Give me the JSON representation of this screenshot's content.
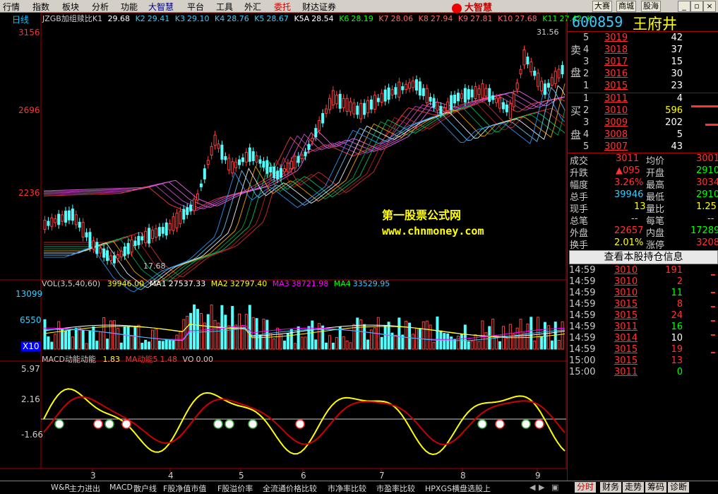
{
  "menu": {
    "items": [
      "行情",
      "指数",
      "板块",
      "分析",
      "功能",
      "大智慧",
      "平台",
      "工具",
      "外汇",
      "委托",
      "财达证券"
    ],
    "brand": "大智慧",
    "right_buttons": [
      "大赛",
      "商城",
      "股海"
    ]
  },
  "chart": {
    "period_label": "日线",
    "header": {
      "title": "JZGB加组赎比K1",
      "k_values": [
        {
          "k": "K1",
          "v": "29.68"
        },
        {
          "k": "K2",
          "v": "29.41"
        },
        {
          "k": "K3",
          "v": "29.10"
        },
        {
          "k": "K4",
          "v": "28.76"
        },
        {
          "k": "K5",
          "v": "28.67"
        },
        {
          "k": "K5A",
          "v": "28.54"
        },
        {
          "k": "K6",
          "v": "28.19"
        },
        {
          "k": "K7",
          "v": "28.06"
        },
        {
          "k": "K8",
          "v": "27.94"
        },
        {
          "k": "K9",
          "v": "27.81"
        },
        {
          "k": "K10",
          "v": "27.68"
        },
        {
          "k": "K11",
          "v": "27.42"
        },
        {
          "k": "K",
          "v": ""
        }
      ]
    },
    "price_axis": [
      "3156",
      "2696",
      "2236"
    ],
    "high_annotation": "31.56",
    "low_annotation": "17.68",
    "watermark_1": "第一股票公式网",
    "watermark_2": "www.chnmoney.com",
    "vol_header": {
      "label": "VOL(3,5,40,60)",
      "v": "39946.00",
      "ma1_label": "MA1",
      "ma1": "27537.33",
      "ma2_label": "MA2",
      "ma2": "32797.40",
      "ma3_label": "MA3",
      "ma3": "38721.98",
      "ma4_label": "MA4",
      "ma4": "33529.95"
    },
    "vol_axis": [
      "13099",
      "6550",
      "X10"
    ],
    "macd_header": {
      "label": "MACD动能动能",
      "v1": "1.83",
      "ma_label": "MA动能5",
      "v2": "1.48",
      "vo_label": "VO",
      "v3": "0.00"
    },
    "macd_axis": [
      "5.97",
      "2.16",
      "-1.66"
    ],
    "x_axis": [
      "3",
      "4",
      "5",
      "6",
      "7",
      "8",
      "9"
    ]
  },
  "quote": {
    "code": "600859",
    "name": "王府井",
    "sell_label": [
      "卖",
      "盘"
    ],
    "buy_label": [
      "买",
      "盘"
    ],
    "sell": [
      {
        "n": "5",
        "p": "3019",
        "v": "42"
      },
      {
        "n": "4",
        "p": "3018",
        "v": "37"
      },
      {
        "n": "3",
        "p": "3017",
        "v": "15"
      },
      {
        "n": "2",
        "p": "3016",
        "v": "30"
      },
      {
        "n": "1",
        "p": "3015",
        "v": "23"
      }
    ],
    "buy": [
      {
        "n": "1",
        "p": "3011",
        "v": "4"
      },
      {
        "n": "2",
        "p": "3010",
        "v": "596"
      },
      {
        "n": "3",
        "p": "3009",
        "v": "202"
      },
      {
        "n": "4",
        "p": "3008",
        "v": "5"
      },
      {
        "n": "5",
        "p": "3007",
        "v": "43"
      }
    ],
    "stats": [
      {
        "l1": "成交",
        "v1": "3011",
        "l2": "均价",
        "v2": "3001"
      },
      {
        "l1": "升跌",
        "v1": "▲095",
        "l2": "开盘",
        "v2": "2910"
      },
      {
        "l1": "幅度",
        "v1": "3.26%",
        "l2": "最高",
        "v2": "3034"
      },
      {
        "l1": "总手",
        "v1": "39946",
        "l2": "最低",
        "v2": "2910"
      },
      {
        "l1": "现手",
        "v1": "13",
        "l2": "量比",
        "v2": "1.25"
      },
      {
        "l1": "总笔",
        "v1": "--",
        "l2": "每笔",
        "v2": "--"
      },
      {
        "l1": "外盘",
        "v1": "22657",
        "l2": "内盘",
        "v2": "17289"
      },
      {
        "l1": "换手",
        "v1": "2.01%",
        "l2": "涨停",
        "v2": "3208"
      }
    ],
    "holdings_button": "查看本股持仓信息",
    "ticks": [
      {
        "t": "14:59",
        "p": "3010",
        "v": "191"
      },
      {
        "t": "14:59",
        "p": "3010",
        "v": "2"
      },
      {
        "t": "14:59",
        "p": "3010",
        "v": "11"
      },
      {
        "t": "14:59",
        "p": "3015",
        "v": "8"
      },
      {
        "t": "14:59",
        "p": "3015",
        "v": "24"
      },
      {
        "t": "14:59",
        "p": "3011",
        "v": "16"
      },
      {
        "t": "14:59",
        "p": "3014",
        "v": "10"
      },
      {
        "t": "14:59",
        "p": "3015",
        "v": "19"
      },
      {
        "t": "15:00",
        "p": "3015",
        "v": "13"
      },
      {
        "t": "15:00",
        "p": "3011",
        "v": "0"
      }
    ]
  },
  "bottom_tabs": [
    "W&R",
    "主力进出",
    "MACD",
    "散户线",
    "F股净值市值",
    "F股溢价率",
    "全流通价格比较",
    "市净率比较",
    "市盈率比较",
    "HPXGS横盘选股上"
  ],
  "bottom_right_tabs": [
    "分时",
    "财务",
    "走势",
    "筹码",
    "诊断"
  ]
}
